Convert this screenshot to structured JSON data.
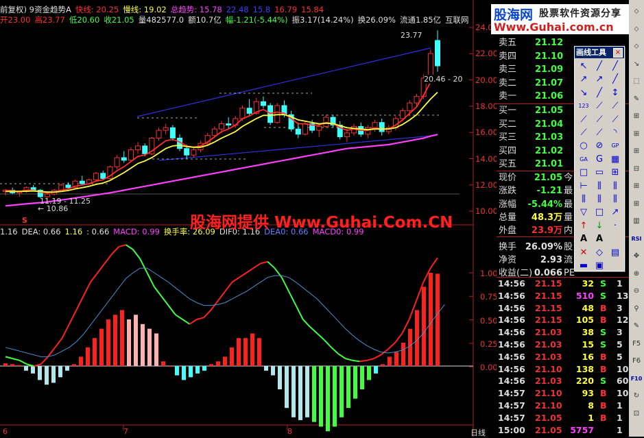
{
  "header": {
    "line1": [
      {
        "text": "前复权) 9资金趋势A",
        "color": "#e0e0e0"
      },
      {
        "text": "快线: 20.25",
        "color": "#ff3030"
      },
      {
        "text": "慢线: 19.02",
        "color": "#ffff40"
      },
      {
        "text": "总趋势: 15.78",
        "color": "#ff40ff"
      },
      {
        "text": "22.48",
        "color": "#4040ff"
      },
      {
        "text": "15.8",
        "color": "#4040ff"
      },
      {
        "text": "16.79",
        "color": "#ff3030"
      },
      {
        "text": "15.84",
        "color": "#ff3030"
      }
    ],
    "line2": [
      {
        "text": "开23.00",
        "color": "#ff3030"
      },
      {
        "text": "高23.77",
        "color": "#ff3030"
      },
      {
        "text": "低20.60",
        "color": "#40ff40"
      },
      {
        "text": "收21.05",
        "color": "#40ff40"
      },
      {
        "text": "量482577.0",
        "color": "#e0e0e0"
      },
      {
        "text": "额10.7亿",
        "color": "#e0e0e0"
      },
      {
        "text": "幅-1.21(-5.44%)",
        "color": "#40ff40"
      },
      {
        "text": "振3.17(14.24%)",
        "color": "#e0e0e0"
      },
      {
        "text": "换26.09%",
        "color": "#e0e0e0"
      },
      {
        "text": "流通1.85亿",
        "color": "#e0e0e0"
      },
      {
        "text": "互联网",
        "color": "#e0e0e0"
      }
    ]
  },
  "chart_annotations": {
    "high_label": "23.77",
    "low_label": "10.86",
    "range_label": "11.19 - 11.25",
    "right_range": "20.46 - 20",
    "s_marker": "S"
  },
  "macd_header": [
    {
      "text": "1.16",
      "color": "#e0e0e0"
    },
    {
      "text": "DEA: 0.66",
      "color": "#e0e0e0"
    },
    {
      "text": "1.16",
      "color": "#ffff40"
    },
    {
      "text": ": 0.66",
      "color": "#e0e0e0"
    },
    {
      "text": "MACD: 0.99",
      "color": "#ff40ff"
    },
    {
      "text": "换手率: 26.09",
      "color": "#ffff40"
    },
    {
      "text": "DIF0: 1.16",
      "color": "#e0e0e0"
    },
    {
      "text": "DEA0: 0.66",
      "color": "#6080ff"
    },
    {
      "text": "MACD0: 0.99",
      "color": "#ff40ff"
    }
  ],
  "price_axis": [
    "24.00",
    "22.00",
    "20.00",
    "18.00",
    "16.00",
    "14.00",
    "12.00",
    "10.00"
  ],
  "macd_axis": [
    "1.00",
    "0.75",
    "0.50",
    "0.25",
    "0.00"
  ],
  "date_axis": [
    "6",
    "7",
    "8",
    "日线"
  ],
  "watermark": "股海网提供 Www.Guhai.Com.CN",
  "logo": {
    "name": "股海网",
    "slogan": "股票软件资源分享",
    "url": "Www.Guhai.com.cn"
  },
  "order_book": {
    "asks": [
      {
        "label": "卖五",
        "price": "21.12"
      },
      {
        "label": "卖四",
        "price": "21.10"
      },
      {
        "label": "卖三",
        "price": "21.09"
      },
      {
        "label": "卖二",
        "price": "21.07"
      },
      {
        "label": "卖一",
        "price": "21.06"
      }
    ],
    "bids": [
      {
        "label": "买一",
        "price": "21.05"
      },
      {
        "label": "买二",
        "price": "21.04"
      },
      {
        "label": "买三",
        "price": "21.03"
      },
      {
        "label": "买四",
        "price": "21.02"
      },
      {
        "label": "买五",
        "price": "21.01"
      }
    ]
  },
  "quote": [
    {
      "label": "现价",
      "value": "21.05",
      "color": "#40ff40",
      "ext": "今"
    },
    {
      "label": "涨跌",
      "value": "-1.21",
      "color": "#40ff40",
      "ext": "最"
    },
    {
      "label": "涨幅",
      "value": "-5.44%",
      "color": "#40ff40",
      "ext": "最"
    },
    {
      "label": "总量",
      "value": "48.3万",
      "color": "#ffff40",
      "ext": "量"
    },
    {
      "label": "外盘",
      "value": "23.9万",
      "color": "#ff3030",
      "ext": "内"
    },
    {
      "label": "换手",
      "value": "26.09%",
      "color": "#e0e0e0",
      "ext": "股"
    },
    {
      "label": "净资",
      "value": "2.93",
      "color": "#e0e0e0",
      "ext": "流"
    },
    {
      "label": "收益(二)",
      "value": "0.066",
      "color": "#e0e0e0",
      "ext": "PE"
    }
  ],
  "ticks": [
    {
      "time": "14:56",
      "price": "21.15",
      "vol": "32",
      "dir": "S",
      "num": "1"
    },
    {
      "time": "14:56",
      "price": "21.15",
      "vol": "510",
      "dir": "S",
      "num": "13"
    },
    {
      "time": "14:56",
      "price": "21.15",
      "vol": "48",
      "dir": "B",
      "num": "3"
    },
    {
      "time": "14:56",
      "price": "21.15",
      "vol": "105",
      "dir": "B",
      "num": "12"
    },
    {
      "time": "14:56",
      "price": "21.03",
      "vol": "38",
      "dir": "S",
      "num": "3"
    },
    {
      "time": "14:56",
      "price": "21.03",
      "vol": "15",
      "dir": "S",
      "num": "5"
    },
    {
      "time": "14:56",
      "price": "21.03",
      "vol": "16",
      "dir": "B",
      "num": "5"
    },
    {
      "time": "14:56",
      "price": "21.10",
      "vol": "138",
      "dir": "B",
      "num": "10"
    },
    {
      "time": "14:56",
      "price": "21.03",
      "vol": "220",
      "dir": "S",
      "num": "60"
    },
    {
      "time": "14:57",
      "price": "21.10",
      "vol": "93",
      "dir": "B",
      "num": "10"
    },
    {
      "time": "14:57",
      "price": "21.10",
      "vol": "8",
      "dir": "B",
      "num": "1"
    },
    {
      "time": "14:57",
      "price": "21.05",
      "vol": "1",
      "dir": "B",
      "num": "1"
    },
    {
      "time": "15:00",
      "price": "21.05",
      "vol": "5757",
      "dir": "",
      "num": "1"
    }
  ],
  "toolbox": {
    "title": "画线工具",
    "close": "×"
  },
  "colors": {
    "up": "#ff3030",
    "down": "#40ffff",
    "accent_blue": "#3040ff",
    "magenta": "#ff40ff"
  },
  "chart_data": [
    {
      "type": "candlestick",
      "title": "9资金趋势A",
      "ylim": [
        10,
        24.5
      ],
      "candles": [
        [
          11.4,
          11.6,
          11.1,
          11.5
        ],
        [
          11.5,
          11.7,
          11.2,
          11.3
        ],
        [
          11.3,
          11.5,
          11.0,
          11.4
        ],
        [
          11.4,
          11.8,
          11.3,
          11.7
        ],
        [
          11.7,
          11.9,
          11.4,
          11.5
        ],
        [
          11.5,
          11.6,
          10.9,
          11.0
        ],
        [
          11.0,
          11.3,
          10.86,
          11.2
        ],
        [
          11.2,
          11.6,
          11.1,
          11.5
        ],
        [
          11.5,
          12.0,
          11.4,
          11.9
        ],
        [
          11.9,
          12.1,
          11.6,
          11.7
        ],
        [
          11.7,
          12.3,
          11.6,
          12.2
        ],
        [
          12.2,
          12.6,
          11.9,
          12.0
        ],
        [
          12.0,
          12.4,
          11.9,
          12.3
        ],
        [
          12.3,
          12.9,
          12.2,
          12.8
        ],
        [
          12.8,
          13.0,
          12.3,
          12.4
        ],
        [
          12.4,
          13.4,
          12.3,
          13.3
        ],
        [
          13.3,
          14.2,
          13.1,
          14.0
        ],
        [
          14.0,
          14.5,
          13.6,
          13.8
        ],
        [
          13.8,
          14.8,
          13.7,
          14.6
        ],
        [
          14.6,
          15.2,
          14.3,
          14.9
        ],
        [
          14.9,
          15.1,
          14.1,
          14.3
        ],
        [
          14.3,
          15.6,
          14.2,
          15.5
        ],
        [
          15.5,
          16.3,
          15.3,
          16.1
        ],
        [
          16.1,
          16.6,
          15.8,
          16.3
        ],
        [
          16.3,
          16.5,
          15.3,
          15.5
        ],
        [
          15.5,
          15.8,
          14.5,
          14.7
        ],
        [
          14.7,
          15.0,
          13.9,
          14.2
        ],
        [
          14.2,
          14.8,
          14.0,
          14.6
        ],
        [
          14.6,
          15.3,
          14.4,
          15.1
        ],
        [
          15.1,
          15.9,
          14.9,
          15.7
        ],
        [
          15.7,
          16.4,
          15.5,
          16.2
        ],
        [
          16.2,
          16.8,
          15.9,
          16.6
        ],
        [
          16.6,
          17.1,
          16.2,
          16.5
        ],
        [
          16.5,
          17.2,
          16.3,
          17.0
        ],
        [
          17.0,
          18.0,
          16.8,
          17.8
        ],
        [
          17.8,
          18.5,
          17.2,
          17.4
        ],
        [
          17.4,
          18.6,
          17.3,
          18.3
        ],
        [
          18.3,
          18.7,
          17.8,
          18.0
        ],
        [
          18.0,
          18.2,
          16.5,
          16.7
        ],
        [
          16.7,
          18.2,
          16.6,
          18.0
        ],
        [
          18.0,
          18.4,
          17.1,
          17.3
        ],
        [
          17.3,
          17.6,
          16.0,
          16.2
        ],
        [
          16.2,
          16.7,
          15.5,
          15.8
        ],
        [
          15.8,
          16.8,
          15.7,
          16.6
        ],
        [
          16.6,
          16.9,
          15.9,
          16.1
        ],
        [
          16.1,
          16.6,
          15.6,
          16.4
        ],
        [
          16.4,
          17.3,
          16.3,
          17.1
        ],
        [
          17.1,
          17.3,
          16.3,
          16.5
        ],
        [
          16.5,
          16.8,
          15.4,
          15.6
        ],
        [
          15.6,
          16.2,
          15.2,
          15.9
        ],
        [
          15.9,
          16.6,
          15.7,
          16.4
        ],
        [
          16.4,
          16.7,
          15.6,
          15.8
        ],
        [
          15.8,
          16.5,
          15.5,
          16.3
        ],
        [
          16.3,
          16.9,
          16.0,
          16.7
        ],
        [
          16.7,
          17.0,
          15.7,
          16.0
        ],
        [
          16.0,
          16.5,
          15.8,
          16.3
        ],
        [
          16.3,
          17.2,
          16.1,
          17.0
        ],
        [
          17.0,
          17.8,
          16.8,
          17.6
        ],
        [
          17.6,
          18.4,
          17.2,
          18.2
        ],
        [
          18.2,
          18.9,
          17.9,
          18.7
        ],
        [
          18.7,
          20.4,
          18.5,
          20.1
        ],
        [
          20.1,
          22.3,
          19.9,
          22.0
        ],
        [
          23.0,
          23.77,
          20.6,
          21.05
        ]
      ],
      "series": [
        {
          "name": "快线",
          "color": "#ff3030",
          "values": [
            11.5,
            11.45,
            11.42,
            11.5,
            11.5,
            11.35,
            11.3,
            11.35,
            11.5,
            11.6,
            11.8,
            11.9,
            12.0,
            12.2,
            12.3,
            12.6,
            13.0,
            13.3,
            13.7,
            14.1,
            14.2,
            14.5,
            14.9,
            15.3,
            15.4,
            15.2,
            14.9,
            14.8,
            14.9,
            15.2,
            15.6,
            16.0,
            16.2,
            16.5,
            17.0,
            17.2,
            17.5,
            17.7,
            17.4,
            17.5,
            17.4,
            17.0,
            16.6,
            16.6,
            16.5,
            16.5,
            16.7,
            16.6,
            16.3,
            16.1,
            16.2,
            16.1,
            16.1,
            16.3,
            16.2,
            16.2,
            16.5,
            16.9,
            17.4,
            17.9,
            18.8,
            19.8,
            20.25
          ]
        },
        {
          "name": "慢线",
          "color": "#ffff40",
          "values": [
            11.4,
            11.4,
            11.4,
            11.42,
            11.44,
            11.4,
            11.36,
            11.36,
            11.4,
            11.48,
            11.6,
            11.7,
            11.8,
            11.95,
            12.05,
            12.25,
            12.55,
            12.85,
            13.2,
            13.55,
            13.75,
            14.0,
            14.35,
            14.7,
            14.9,
            14.95,
            14.85,
            14.8,
            14.8,
            14.95,
            15.2,
            15.5,
            15.75,
            16.0,
            16.4,
            16.7,
            17.0,
            17.25,
            17.25,
            17.3,
            17.3,
            17.15,
            16.9,
            16.8,
            16.7,
            16.6,
            16.65,
            16.62,
            16.45,
            16.3,
            16.25,
            16.2,
            16.15,
            16.2,
            16.2,
            16.2,
            16.3,
            16.55,
            16.9,
            17.3,
            17.9,
            18.5,
            19.02
          ]
        },
        {
          "name": "总趋势",
          "color": "#ff40ff",
          "values": [
            10.3,
            10.35,
            10.4,
            10.45,
            10.5,
            10.55,
            10.6,
            10.68,
            10.75,
            10.82,
            10.9,
            10.98,
            11.06,
            11.14,
            11.22,
            11.3,
            11.4,
            11.5,
            11.6,
            11.7,
            11.8,
            11.9,
            12.0,
            12.1,
            12.2,
            12.3,
            12.4,
            12.5,
            12.6,
            12.7,
            12.8,
            12.9,
            13.0,
            13.1,
            13.2,
            13.3,
            13.4,
            13.5,
            13.6,
            13.7,
            13.8,
            13.9,
            14.0,
            14.1,
            14.2,
            14.3,
            14.4,
            14.5,
            14.6,
            14.7,
            14.75,
            14.8,
            14.85,
            14.9,
            14.95,
            15.0,
            15.1,
            15.2,
            15.3,
            15.4,
            15.5,
            15.65,
            15.78
          ]
        }
      ]
    },
    {
      "type": "bar",
      "title": "MACD",
      "ylim": [
        -0.75,
        1.2
      ],
      "values": [
        0.03,
        0.02,
        0.01,
        -0.05,
        -0.08,
        -0.15,
        -0.2,
        -0.18,
        -0.12,
        -0.05,
        0.02,
        0.1,
        0.2,
        0.3,
        0.4,
        0.5,
        0.55,
        0.6,
        0.5,
        0.55,
        0.45,
        0.4,
        0.35,
        0.05,
        0.0,
        -0.1,
        -0.15,
        -0.12,
        -0.08,
        -0.05,
        0.02,
        0.05,
        0.1,
        0.2,
        0.3,
        0.3,
        0.35,
        0.3,
        -0.05,
        -0.1,
        -0.25,
        -0.45,
        -0.55,
        -0.58,
        -0.55,
        -0.6,
        -0.65,
        -0.7,
        -0.65,
        -0.55,
        -0.45,
        -0.35,
        -0.25,
        -0.15,
        -0.08,
        0.02,
        0.1,
        0.15,
        0.25,
        0.4,
        0.6,
        0.85,
        1.0,
        0.99
      ],
      "dif": [
        0.1,
        0.08,
        0.06,
        0.02,
        0.0,
        0.02,
        0.1,
        0.2,
        0.3,
        0.45,
        0.6,
        0.75,
        0.9,
        1.0,
        1.1,
        1.2,
        1.28,
        1.3,
        1.25,
        1.15,
        1.0,
        0.85,
        0.75,
        0.65,
        0.55,
        0.5,
        0.45,
        0.5,
        0.52,
        0.6,
        0.7,
        0.8,
        0.9,
        0.95,
        1.0,
        1.05,
        1.1,
        1.12,
        1.05,
        0.95,
        0.8,
        0.65,
        0.5,
        0.42,
        0.35,
        0.28,
        0.2,
        0.13,
        0.08,
        0.06,
        0.05,
        0.06,
        0.08,
        0.12,
        0.18,
        0.25,
        0.35,
        0.5,
        0.7,
        0.9,
        1.05,
        1.16
      ],
      "dea": [
        0.2,
        0.18,
        0.16,
        0.14,
        0.12,
        0.1,
        0.1,
        0.12,
        0.16,
        0.2,
        0.26,
        0.34,
        0.44,
        0.54,
        0.64,
        0.74,
        0.84,
        0.94,
        1.0,
        1.05,
        1.05,
        1.0,
        0.95,
        0.9,
        0.84,
        0.78,
        0.72,
        0.68,
        0.65,
        0.65,
        0.66,
        0.68,
        0.72,
        0.76,
        0.8,
        0.85,
        0.9,
        0.95,
        0.97,
        0.97,
        0.95,
        0.9,
        0.84,
        0.78,
        0.72,
        0.64,
        0.56,
        0.48,
        0.4,
        0.33,
        0.27,
        0.22,
        0.18,
        0.15,
        0.14,
        0.15,
        0.17,
        0.21,
        0.27,
        0.35,
        0.46,
        0.56,
        0.66
      ]
    }
  ]
}
